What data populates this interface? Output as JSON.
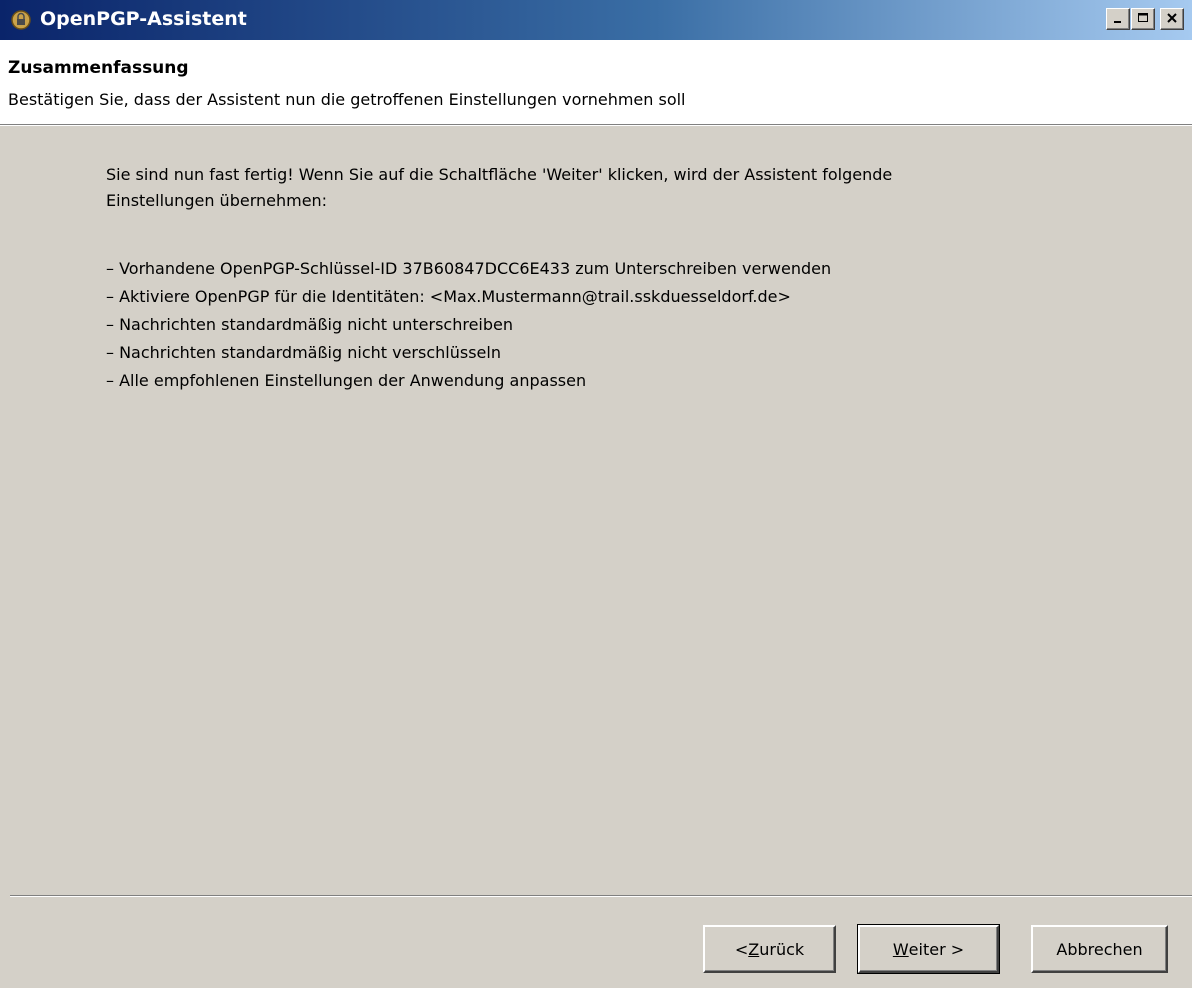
{
  "window": {
    "title": "OpenPGP-Assistent",
    "app_icon": "pgp-assistant-icon",
    "controls": {
      "minimize": "minimize-icon",
      "maximize": "maximize-icon",
      "close": "close-icon"
    }
  },
  "header": {
    "title": "Zusammenfassung",
    "subtitle": "Bestätigen Sie, dass der Assistent nun die getroffenen Einstellungen vornehmen soll"
  },
  "main": {
    "intro": "Sie sind nun fast fertig! Wenn Sie auf die Schaltfläche 'Weiter' klicken, wird der Assistent folgende\nEinstellungen übernehmen:",
    "items": [
      "– Vorhandene OpenPGP-Schlüssel-ID 37B60847DCC6E433 zum Unterschreiben verwenden",
      "– Aktiviere OpenPGP für die Identitäten: <Max.Mustermann@trail.sskduesseldorf.de>",
      "– Nachrichten standardmäßig nicht unterschreiben",
      "– Nachrichten standardmäßig nicht verschlüsseln",
      "– Alle empfohlenen Einstellungen der Anwendung anpassen"
    ]
  },
  "footer": {
    "back": {
      "prefix": "< ",
      "mnemonic": "Z",
      "rest": "urück"
    },
    "next": {
      "mnemonic": "W",
      "rest": "eiter >"
    },
    "cancel": "Abbrechen"
  },
  "colors": {
    "dialog_bg": "#d4d0c8",
    "titlebar_start": "#0a246a",
    "titlebar_end": "#a6caf0",
    "header_bg": "#ffffff"
  }
}
